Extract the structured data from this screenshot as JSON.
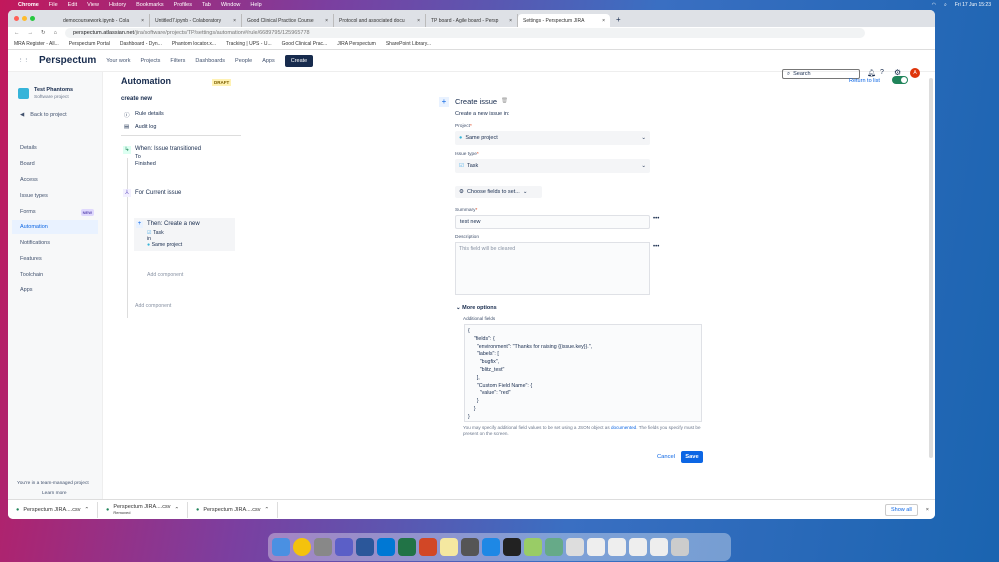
{
  "menubar": {
    "items": [
      "Chrome",
      "File",
      "Edit",
      "View",
      "History",
      "Bookmarks",
      "Profiles",
      "Tab",
      "Window",
      "Help"
    ],
    "datetime": "Fri 17 Jun 15:23"
  },
  "tabs": [
    {
      "label": "democoursework.ipynb - Cola"
    },
    {
      "label": "Untitled7.ipynb - Colaboratory"
    },
    {
      "label": "Good Clinical Practice Course"
    },
    {
      "label": "Protocol and associated docu"
    },
    {
      "label": "TP board - Agile board - Persp"
    },
    {
      "label": "Settings - Perspectum JIRA"
    }
  ],
  "url": {
    "host": "perspectum.atlassian.net",
    "path": "/jira/software/projects/TP/settings/automation#/rule/6689795/125965778"
  },
  "bookmarks": [
    "MRA Register - All...",
    "Perspectum Portal",
    "Dashboard - Dyn...",
    "Phantom locator.x...",
    "Tracking | UPS - U...",
    "Good Clinical Prac...",
    "JIRA Perspectum",
    "SharePoint Library..."
  ],
  "header": {
    "logo": "Perspectum",
    "nav": [
      "Your work",
      "Projects",
      "Filters",
      "Dashboards",
      "People",
      "Apps"
    ],
    "create": "Create",
    "search_placeholder": "Search",
    "avatar": "A"
  },
  "sidebar": {
    "project_name": "Test Phantoms",
    "project_type": "Software project",
    "back": "Back to project",
    "items": [
      "Details",
      "Board",
      "Access",
      "Issue types",
      "Forms",
      "Automation",
      "Notifications",
      "Features",
      "Toolchain",
      "Apps"
    ],
    "new_badge": "NEW",
    "footer": "You're in a team-managed project",
    "learn_more": "Learn more"
  },
  "rule": {
    "title": "Automation",
    "status": "DRAFT",
    "name": "create new",
    "rule_details": "Rule details",
    "audit_log": "Audit log",
    "trigger": "When: Issue transitioned",
    "trigger_to": "To",
    "trigger_status": "Finished",
    "branch": "For Current issue",
    "action": "Then: Create a new",
    "action_type": "Task",
    "action_in": "in",
    "action_project": "Same project",
    "add_component": "Add component",
    "return": "Return to list"
  },
  "panel": {
    "title": "Create issue",
    "subtitle": "Create a new issue in:",
    "project_label": "Project",
    "project_value": "Same project",
    "type_label": "Issue type",
    "type_value": "Task",
    "choose_fields": "Choose fields to set...",
    "summary_label": "Summary",
    "summary_value": "test new",
    "description_label": "Description",
    "description_placeholder": "This field will be cleared",
    "more_options": "More options",
    "additional_label": "Additional fields",
    "json": "{\n    \"fields\": {\n      \"environment\": \"Thanks for raising {{issue.key}}.\",\n      \"labels\": [\n        \"bugfix\",\n        \"blitz_test\"\n      ],\n      \"Custom Field Name\": {\n        \"value\": \"red\"\n      }\n    }\n}",
    "help_pre": "You may specify additional field values to be set using a JSON object as",
    "help_link": "documented",
    "help_post": ". The fields you specify must be present on the screen.",
    "cancel": "Cancel",
    "save": "Save"
  },
  "downloads": {
    "items": [
      {
        "name": "Perspectum JIRA....csv",
        "status": ""
      },
      {
        "name": "Perspectum JIRA....csv",
        "status": "Removed"
      },
      {
        "name": "Perspectum JIRA....csv",
        "status": ""
      }
    ],
    "show_all": "Show all"
  }
}
